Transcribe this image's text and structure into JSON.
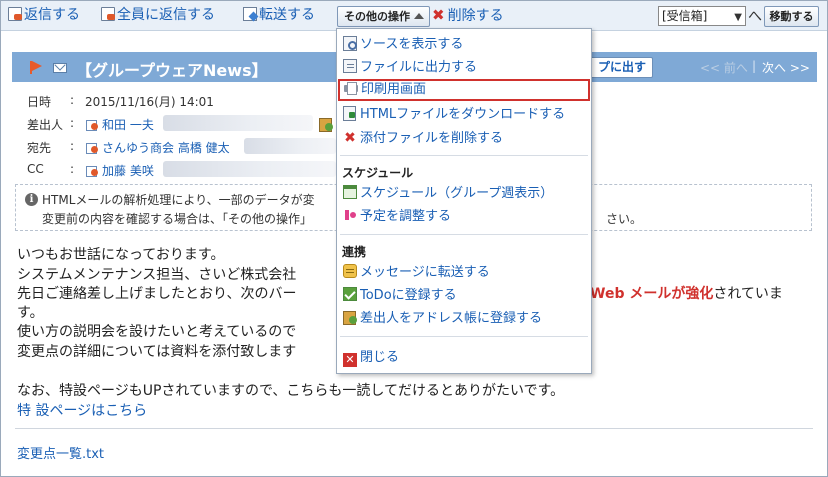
{
  "toolbar": {
    "reply": "返信する",
    "reply_all": "全員に返信する",
    "forward": "転送する",
    "other_actions": "その他の操作",
    "delete": "削除する",
    "folder_selected": "[受信箱]",
    "folder_suffix": "へ",
    "move": "移動する"
  },
  "message": {
    "title": "【グループウェアNews】",
    "popout_button": "プに出す",
    "nav_prev": "<< 前へ",
    "nav_sep": "|",
    "nav_next": "次へ >>",
    "date_label": "日時",
    "date_value": "2015/11/16(月) 14:01",
    "from_label": "差出人",
    "from_name": "和田 一夫",
    "to_label": "宛先",
    "to_name": "さんゆう商会 高橋 健太",
    "cc_label": "CC",
    "cc_name": "加藤 美咲",
    "colon": ":"
  },
  "info": {
    "line1": "HTMLメールの解析処理により、一部のデータが変",
    "line2": "変更前の内容を確認する場合は、「その他の操作」",
    "line2_tail": "さい。"
  },
  "body": {
    "line1": "いつもお世話になっております。",
    "line2": "システムメンテナンス担当、さいど株式会社",
    "line3": "先日ご連絡差し上げましたとおり、次のバー",
    "line3_highlight": "Web メールが強化",
    "line3_tail": "されていま",
    "line4": "す。",
    "line5": "使い方の説明会を設けたいと考えているので",
    "line6": "変更点の詳細については資料を添付致します",
    "line7": "なお、特設ページもUPされていますので、こちらも一読してだけるとありがたいです。",
    "link": "特 設ページはこちら",
    "attachment": "変更点一覧.txt"
  },
  "menu": {
    "items_top": [
      {
        "label": "ソースを表示する"
      },
      {
        "label": "ファイルに出力する"
      },
      {
        "label": "印刷用画面"
      },
      {
        "label": "HTMLファイルをダウンロードする"
      },
      {
        "label": "添付ファイルを削除する"
      }
    ],
    "section_schedule": "スケジュール",
    "items_schedule": [
      {
        "label": "スケジュール（グループ週表示）"
      },
      {
        "label": "予定を調整する"
      }
    ],
    "section_link": "連携",
    "items_link": [
      {
        "label": "メッセージに転送する"
      },
      {
        "label": "ToDoに登録する"
      },
      {
        "label": "差出人をアドレス帳に登録する"
      }
    ],
    "close": "閉じる"
  },
  "colors": {
    "accent": "#1a5fb4",
    "title_bar": "#7fa9d6",
    "danger": "#d0312d"
  }
}
